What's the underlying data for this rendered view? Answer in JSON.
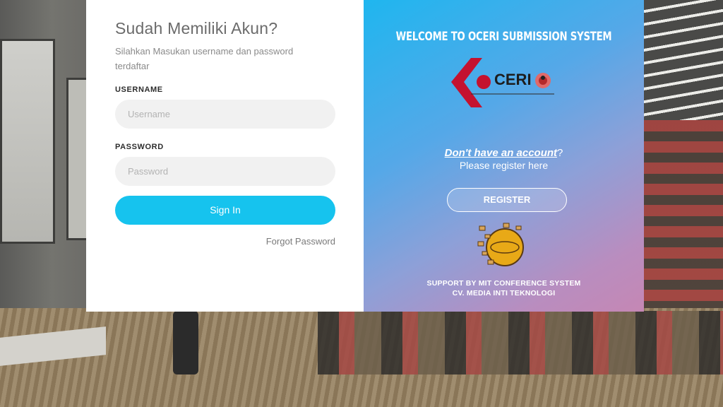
{
  "login": {
    "title": "Sudah Memiliki Akun?",
    "subtitle": "Silahkan Masukan username dan password terdaftar",
    "username_label": "USERNAME",
    "username_placeholder": "Username",
    "password_label": "PASSWORD",
    "password_placeholder": "Password",
    "signin_label": "Sign In",
    "forgot_label": "Forgot Password"
  },
  "welcome": {
    "heading": "WELCOME TO OCERI SUBMISSION SYSTEM",
    "logo_text": "CERI",
    "dont_have": "Don't have an account",
    "dont_have_suffix": "?",
    "register_hint": "Please register here",
    "register_label": "REGISTER",
    "support_line1": "SUPPORT BY MIT CONFERENCE SYSTEM",
    "support_line2": "CV. MEDIA INTI TEKNOLOGI"
  },
  "colors": {
    "accent": "#16c3ee",
    "panel_start": "#1fb6ef",
    "panel_end": "#c587b4",
    "logo_red": "#c4122f"
  },
  "icons": {
    "ceri_logo": "oceri-logo",
    "mit_logo": "mit-conference-system-logo"
  }
}
